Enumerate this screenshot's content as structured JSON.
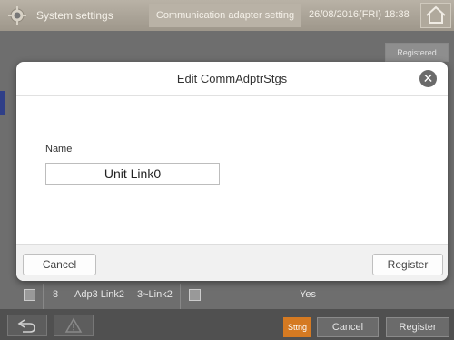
{
  "header": {
    "title": "System settings",
    "tab": "Communication adapter setting",
    "datetime": "26/08/2016(FRI) 18:38"
  },
  "background": {
    "registered_label": "Registered",
    "row": {
      "number": "8",
      "name": "Adp3 Link2",
      "range": "3~Link2",
      "value": "Yes"
    }
  },
  "bottom_bar": {
    "sttng_label": "Sttng",
    "cancel_label": "Cancel",
    "register_label": "Register"
  },
  "dialog": {
    "title": "Edit CommAdptrStgs",
    "close_symbol": "✕",
    "name_label": "Name",
    "name_value": "Unit Link0",
    "cancel_label": "Cancel",
    "register_label": "Register"
  },
  "icons": {
    "gear": "gear-icon",
    "home": "home-icon",
    "back": "back-arrow-icon",
    "warning": "warning-icon",
    "close": "close-icon"
  },
  "colors": {
    "accent_orange": "#d57a22",
    "topbar": "#aaa397",
    "left_accent": "#2f3f88"
  }
}
